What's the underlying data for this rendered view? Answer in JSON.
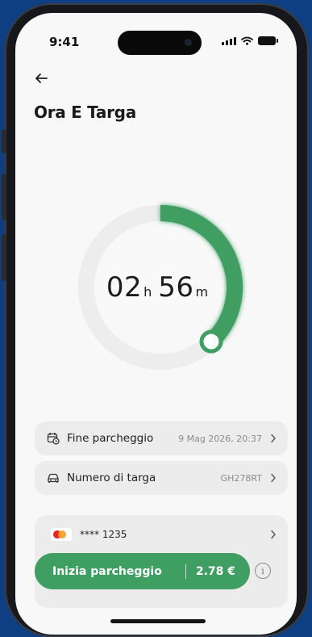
{
  "status_bar": {
    "time": "9:41"
  },
  "header": {
    "title": "Ora E Targa"
  },
  "timer": {
    "hours": "02",
    "hours_unit": "h",
    "minutes": "56",
    "minutes_unit": "m",
    "progress_fraction": 0.38
  },
  "details": {
    "end_parking": {
      "label": "Fine parcheggio",
      "value": "9 Mag 2026, 20:37"
    },
    "plate": {
      "label": "Numero di targa",
      "value": "GH278RT"
    }
  },
  "payment": {
    "card_number": "**** 1235"
  },
  "cta": {
    "label": "Inizia parcheggio",
    "price": "2.78 €"
  },
  "info": {
    "glyph": "i"
  },
  "colors": {
    "accent": "#3f9e62",
    "background": "#0e3f82"
  },
  "icons": [
    "back-arrow-icon",
    "calendar-clock-icon",
    "car-icon",
    "chevron-right-icon",
    "mastercard-icon",
    "info-icon"
  ]
}
